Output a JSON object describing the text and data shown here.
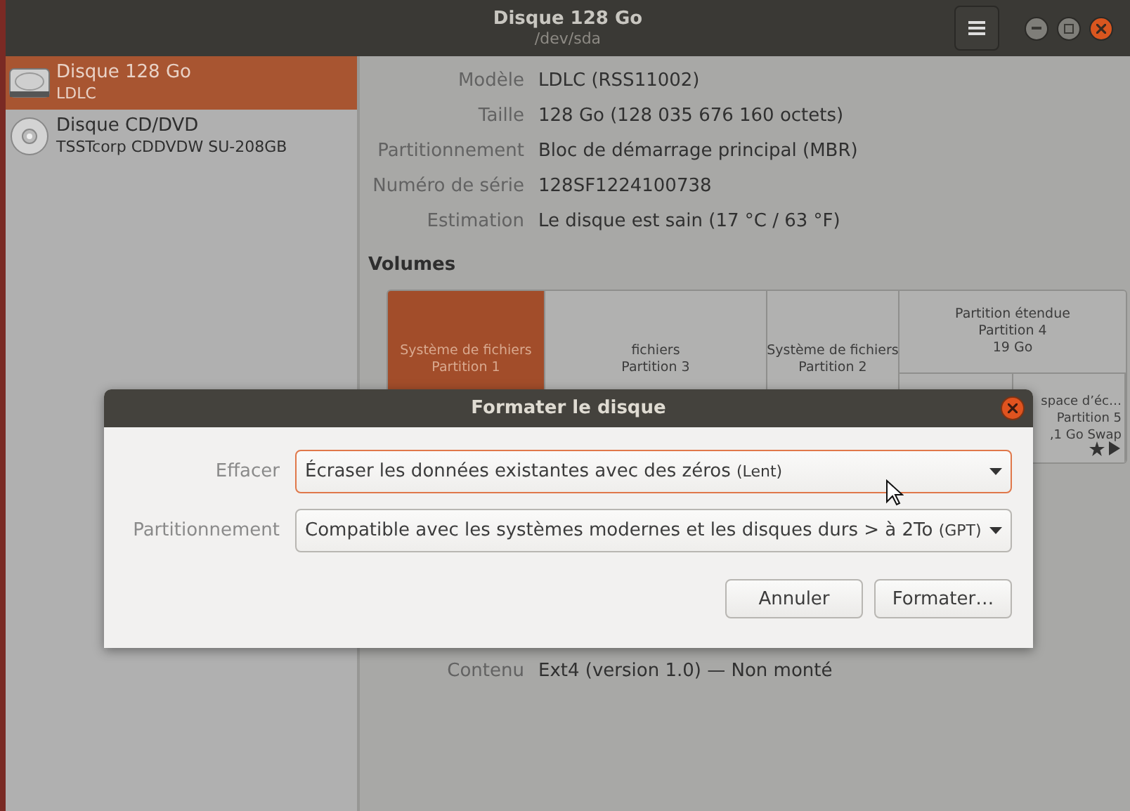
{
  "window": {
    "title": "Disque 128 Go",
    "subtitle": "/dev/sda"
  },
  "sidebar": {
    "items": [
      {
        "kind": "hdd",
        "name": "Disque 128 Go",
        "detail": "LDLC",
        "selected": true
      },
      {
        "kind": "optical",
        "name": "Disque CD/DVD",
        "detail": "TSSTcorp CDDVDW SU-208GB",
        "selected": false
      }
    ]
  },
  "drive_info": [
    {
      "label": "Modèle",
      "value": "LDLC (RSS11002)"
    },
    {
      "label": "Taille",
      "value": "128 Go (128 035 676 160 octets)"
    },
    {
      "label": "Partitionnement",
      "value": "Bloc de démarrage principal (MBR)"
    },
    {
      "label": "Numéro de série",
      "value": "128SF1224100738"
    },
    {
      "label": "Estimation",
      "value": "Le disque est sain (17 °C / 63 °F)"
    }
  ],
  "volumes": {
    "heading": "Volumes",
    "blocks": [
      {
        "lines": [
          "Système de fichiers",
          "Partition 1"
        ],
        "selected": true
      },
      {
        "lines": [
          "fichiers",
          "Partition 3"
        ],
        "selected": false
      },
      {
        "lines": [
          "Système de fichiers",
          "Partition 2"
        ],
        "selected": false
      }
    ],
    "extended": {
      "lines": [
        "Partition étendue",
        "Partition 4",
        "19 Go"
      ],
      "selected": false,
      "children": [
        {
          "selected": false
        },
        {
          "lines": [
            "space d’éc…",
            "Partition 5",
            "‚1 Go Swap"
          ],
          "selected": false
        }
      ]
    }
  },
  "volume_info": [
    {
      "label": "Contenu",
      "value": "Ext4 (version 1.0) — Non monté"
    }
  ],
  "dialog": {
    "title": "Formater le disque",
    "fields": [
      {
        "label": "Effacer",
        "value": "Écraser les données existantes avec des zéros",
        "hint": "(Lent)",
        "focused": true
      },
      {
        "label": "Partitionnement",
        "value": "Compatible avec les systèmes modernes et les disques durs > à 2To",
        "hint": "(GPT)",
        "focused": false
      }
    ],
    "buttons": [
      "Annuler",
      "Formater…"
    ]
  }
}
